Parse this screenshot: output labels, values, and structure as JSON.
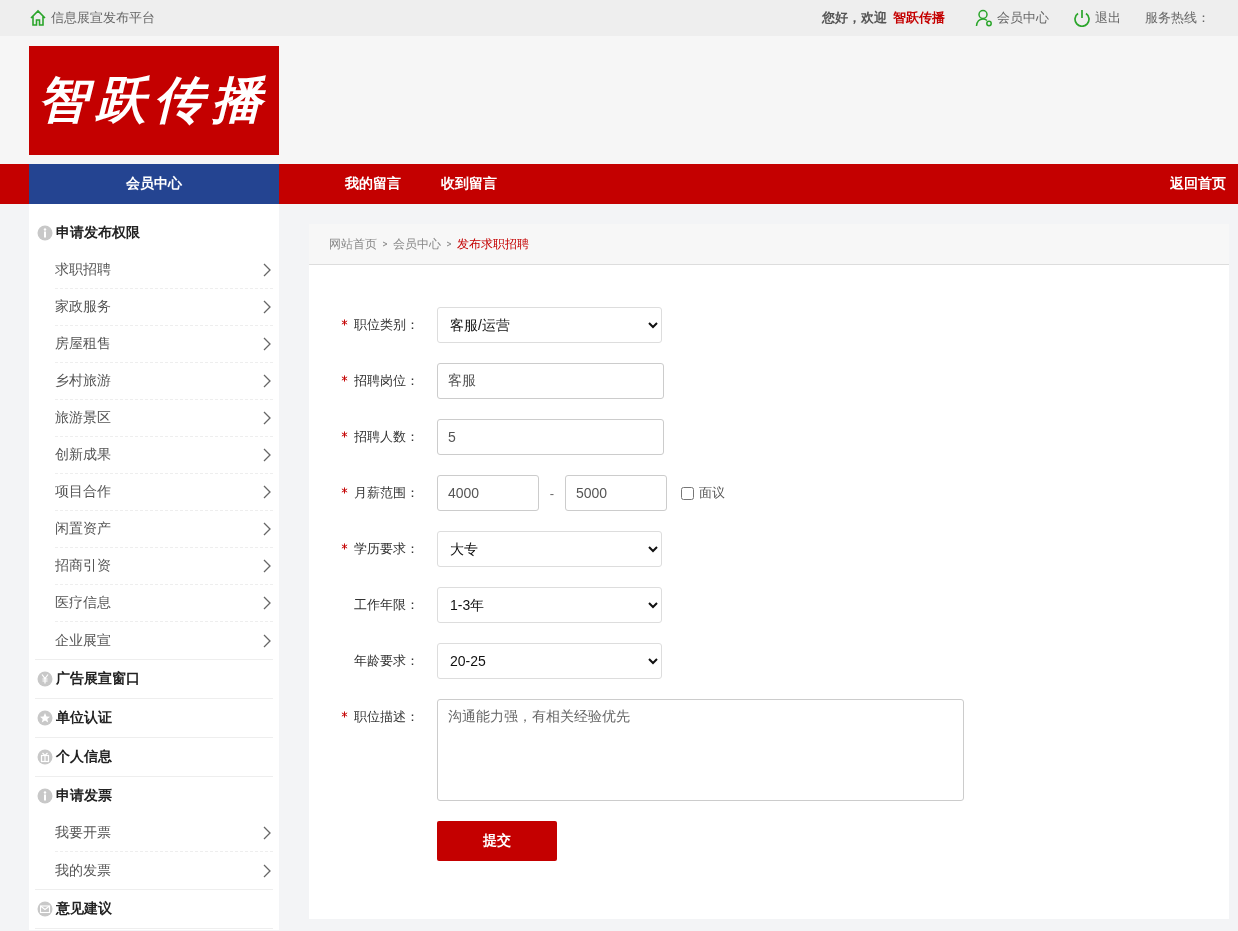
{
  "top_bar": {
    "site_link": "信息展宣发布平台",
    "greeting": "您好，欢迎",
    "username": "智跃传播",
    "member_link": "会员中心",
    "logout_link": "退出",
    "hotline": "服务热线："
  },
  "logo": {
    "text": "智跃传播"
  },
  "nav": {
    "items": [
      {
        "label": "会员中心",
        "selected": true
      },
      {
        "label": "我的留言",
        "selected": false
      },
      {
        "label": "收到留言",
        "selected": false
      }
    ],
    "home_link": "返回首页"
  },
  "sidebar": {
    "sections": [
      {
        "title": "申请发布权限",
        "kind": "info",
        "children": [
          {
            "label": "求职招聘"
          },
          {
            "label": "家政服务"
          },
          {
            "label": "房屋租售"
          },
          {
            "label": "乡村旅游"
          },
          {
            "label": "旅游景区"
          },
          {
            "label": "创新成果"
          },
          {
            "label": "项目合作"
          },
          {
            "label": "闲置资产"
          },
          {
            "label": "招商引资"
          },
          {
            "label": "医疗信息"
          },
          {
            "label": "企业展宣"
          }
        ]
      },
      {
        "title": "广告展宣窗口",
        "kind": "money"
      },
      {
        "title": "单位认证",
        "kind": "star"
      },
      {
        "title": "个人信息",
        "kind": "gift"
      },
      {
        "title": "申请发票",
        "kind": "info",
        "children": [
          {
            "label": "我要开票"
          },
          {
            "label": "我的发票"
          }
        ]
      },
      {
        "title": "意见建议",
        "kind": "mail"
      }
    ]
  },
  "breadcrumb": [
    {
      "label": "网站首页",
      "selected": false
    },
    {
      "label": "会员中心",
      "selected": false
    },
    {
      "label": "发布求职招聘",
      "selected": true
    }
  ],
  "form": {
    "fields": [
      {
        "label": "职位类别：",
        "required": true,
        "kind": "select",
        "value": "客服/运营"
      },
      {
        "label": "招聘岗位：",
        "required": true,
        "kind": "text",
        "value": "客服"
      },
      {
        "label": "招聘人数：",
        "required": true,
        "kind": "text",
        "value": "5"
      },
      {
        "label": "月薪范围：",
        "required": true,
        "kind": "range",
        "from": "4000",
        "separator": "-",
        "to": "5000",
        "option": {
          "label": "面议",
          "checked": false
        }
      },
      {
        "label": "学历要求：",
        "required": true,
        "kind": "select",
        "value": "大专"
      },
      {
        "label": "工作年限：",
        "required": false,
        "kind": "select",
        "value": "1-3年"
      },
      {
        "label": "年龄要求：",
        "required": false,
        "kind": "select",
        "value": "20-25"
      },
      {
        "label": "职位描述：",
        "required": true,
        "kind": "textarea",
        "value": "沟通能力强，有相关经验优先"
      }
    ],
    "submit": "提交"
  }
}
